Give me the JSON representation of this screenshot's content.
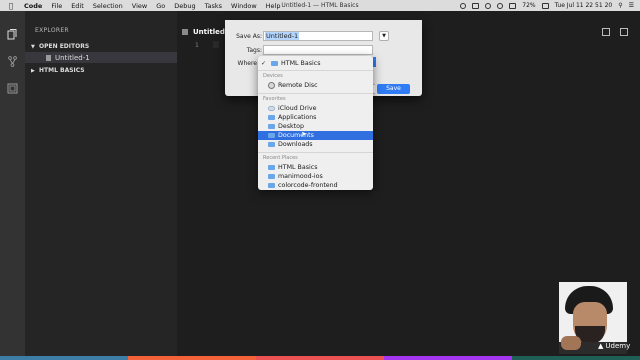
{
  "menubar": {
    "app": "Code",
    "items": [
      "File",
      "Edit",
      "Selection",
      "View",
      "Go",
      "Debug",
      "Tasks",
      "Window",
      "Help"
    ],
    "window_title": "Untitled-1 — HTML Basics",
    "battery": "72%",
    "clock": "Tue Jul 11  22 51 20"
  },
  "sidebar": {
    "header": "EXPLORER",
    "open_editors": "OPEN EDITORS",
    "open_file": "Untitled-1",
    "folder": "HTML BASICS"
  },
  "editor": {
    "tab_label": "Untitled-1",
    "line_number": "1"
  },
  "dialog": {
    "save_as_label": "Save As:",
    "save_as_value": "Untitled-1",
    "tags_label": "Tags:",
    "where_label": "Where",
    "save_button": "Save"
  },
  "where_menu": {
    "selected": "HTML Basics",
    "devices_header": "Devices",
    "devices": [
      "Remote Disc"
    ],
    "favorites_header": "Favorites",
    "favorites": [
      "iCloud Drive",
      "Applications",
      "Desktop",
      "Documents",
      "Downloads"
    ],
    "highlighted": "Documents",
    "recent_header": "Recent Places",
    "recent": [
      "HTML Basics",
      "manimood-ios",
      "colorcode-frontend"
    ]
  },
  "watermark": {
    "brand": "Udemy"
  },
  "colors": {
    "accent_blue": "#2f7cf6",
    "bottom_bar": [
      "#3d7ea6",
      "#ec5252",
      "#f4623a",
      "#a435f0",
      "#1e6055",
      "#3d7ea6"
    ]
  }
}
